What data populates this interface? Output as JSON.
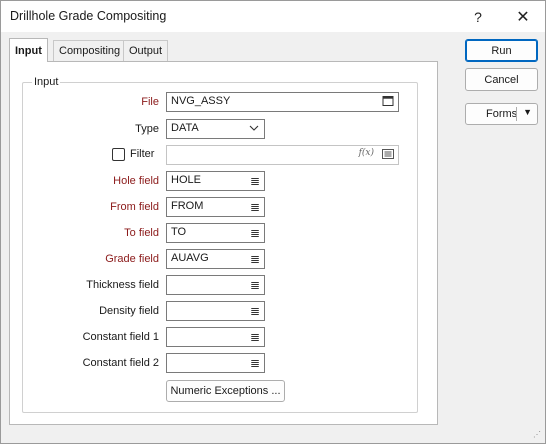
{
  "window": {
    "title": "Drillhole Grade Compositing",
    "help_glyph": "?",
    "close_glyph": "✕"
  },
  "tabs": [
    {
      "label": "Input",
      "active": true
    },
    {
      "label": "Compositing",
      "active": false
    },
    {
      "label": "Output",
      "active": false
    }
  ],
  "group": {
    "legend": "Input"
  },
  "fields": {
    "file": {
      "label": "File",
      "value": "NVG_ASSY",
      "icon": "file-browse-icon"
    },
    "type": {
      "label": "Type",
      "value": "DATA"
    },
    "filter": {
      "label": "Filter",
      "checked": false,
      "value": "",
      "expr_icon": "f(x)"
    },
    "hole": {
      "label": "Hole field",
      "value": "HOLE"
    },
    "from": {
      "label": "From field",
      "value": "FROM"
    },
    "to": {
      "label": "To field",
      "value": "TO"
    },
    "grade": {
      "label": "Grade field",
      "value": "AUAVG"
    },
    "thickness": {
      "label": "Thickness field",
      "value": ""
    },
    "density": {
      "label": "Density field",
      "value": ""
    },
    "constant1": {
      "label": "Constant field 1",
      "value": ""
    },
    "constant2": {
      "label": "Constant field 2",
      "value": ""
    }
  },
  "buttons": {
    "numeric_exceptions": "Numeric Exceptions ...",
    "run": "Run",
    "cancel": "Cancel",
    "forms": "Forms"
  },
  "colors": {
    "required_label": "#8b1a1a",
    "primary_border": "#0067c0"
  }
}
